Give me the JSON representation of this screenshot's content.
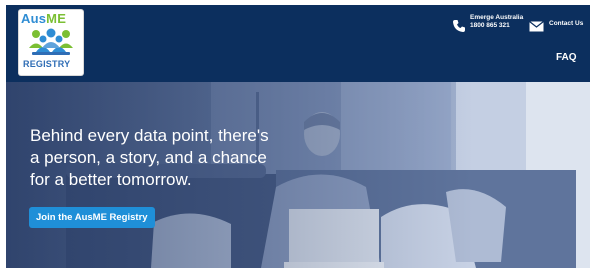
{
  "logo": {
    "line1_part_a": "Aus",
    "line1_part_b": "ME",
    "line2": "REGISTRY"
  },
  "header": {
    "phone_label": "Emerge Australia",
    "phone_number": "1800 865 321",
    "contact_label": "Contact Us",
    "faq_label": "FAQ"
  },
  "hero": {
    "headline_line1": "Behind every data point, there's",
    "headline_line2": "a person, a story, and a chance",
    "headline_line3": "for a better tomorrow.",
    "cta_label": "Join the AusME Registry"
  },
  "icons": {
    "phone": "phone-icon",
    "mail": "mail-icon"
  },
  "colors": {
    "header_bg": "#0c2f5e",
    "cta_bg": "#1f8fd8",
    "logo_blue": "#2f8dd4",
    "logo_green": "#7bbf33"
  }
}
